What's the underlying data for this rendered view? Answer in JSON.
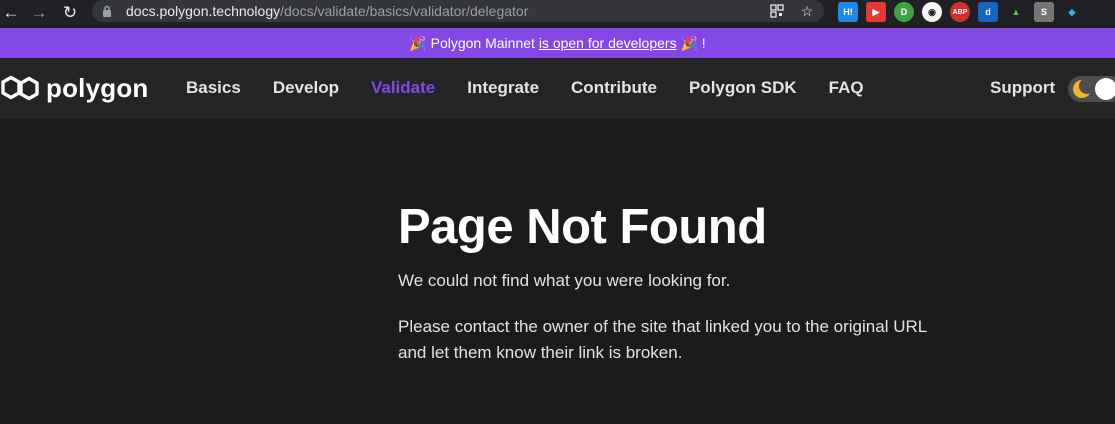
{
  "browser": {
    "url_host": "docs.polygon.technology",
    "url_path": "/docs/validate/basics/validator/delegator",
    "extensions": [
      {
        "name": "hi",
        "label": "H!",
        "color": "#1e88e5"
      },
      {
        "name": "video",
        "label": "▶",
        "color": "#e53935"
      },
      {
        "name": "green",
        "label": "D",
        "color": "#43a047"
      },
      {
        "name": "avatar",
        "label": "◉",
        "color": "#f5f5f5"
      },
      {
        "name": "abp",
        "label": "ABP",
        "color": "#d32f2f"
      },
      {
        "name": "d-ext",
        "label": "d",
        "color": "#1565c0"
      },
      {
        "name": "chart-ext",
        "label": "▲",
        "color": "#2e7d32"
      },
      {
        "name": "s-ext",
        "label": "S",
        "color": "#757575"
      },
      {
        "name": "diamond-ext",
        "label": "◆",
        "color": "#039be5"
      }
    ]
  },
  "announcement": {
    "emoji": "🎉",
    "prefix": "Polygon Mainnet ",
    "link_text": "is open for developers",
    "suffix": "!"
  },
  "navbar": {
    "brand": "polygon",
    "links": [
      "Basics",
      "Develop",
      "Validate",
      "Integrate",
      "Contribute",
      "Polygon SDK",
      "FAQ"
    ],
    "active": "Validate",
    "support": "Support"
  },
  "main": {
    "title": "Page Not Found",
    "paragraph1": "We could not find what you were looking for.",
    "paragraph2": "Please contact the owner of the site that linked you to the original URL and let them know their link is broken."
  },
  "colors": {
    "accent": "#8247e5",
    "background": "#1b1b1d",
    "navbar": "#242526"
  }
}
